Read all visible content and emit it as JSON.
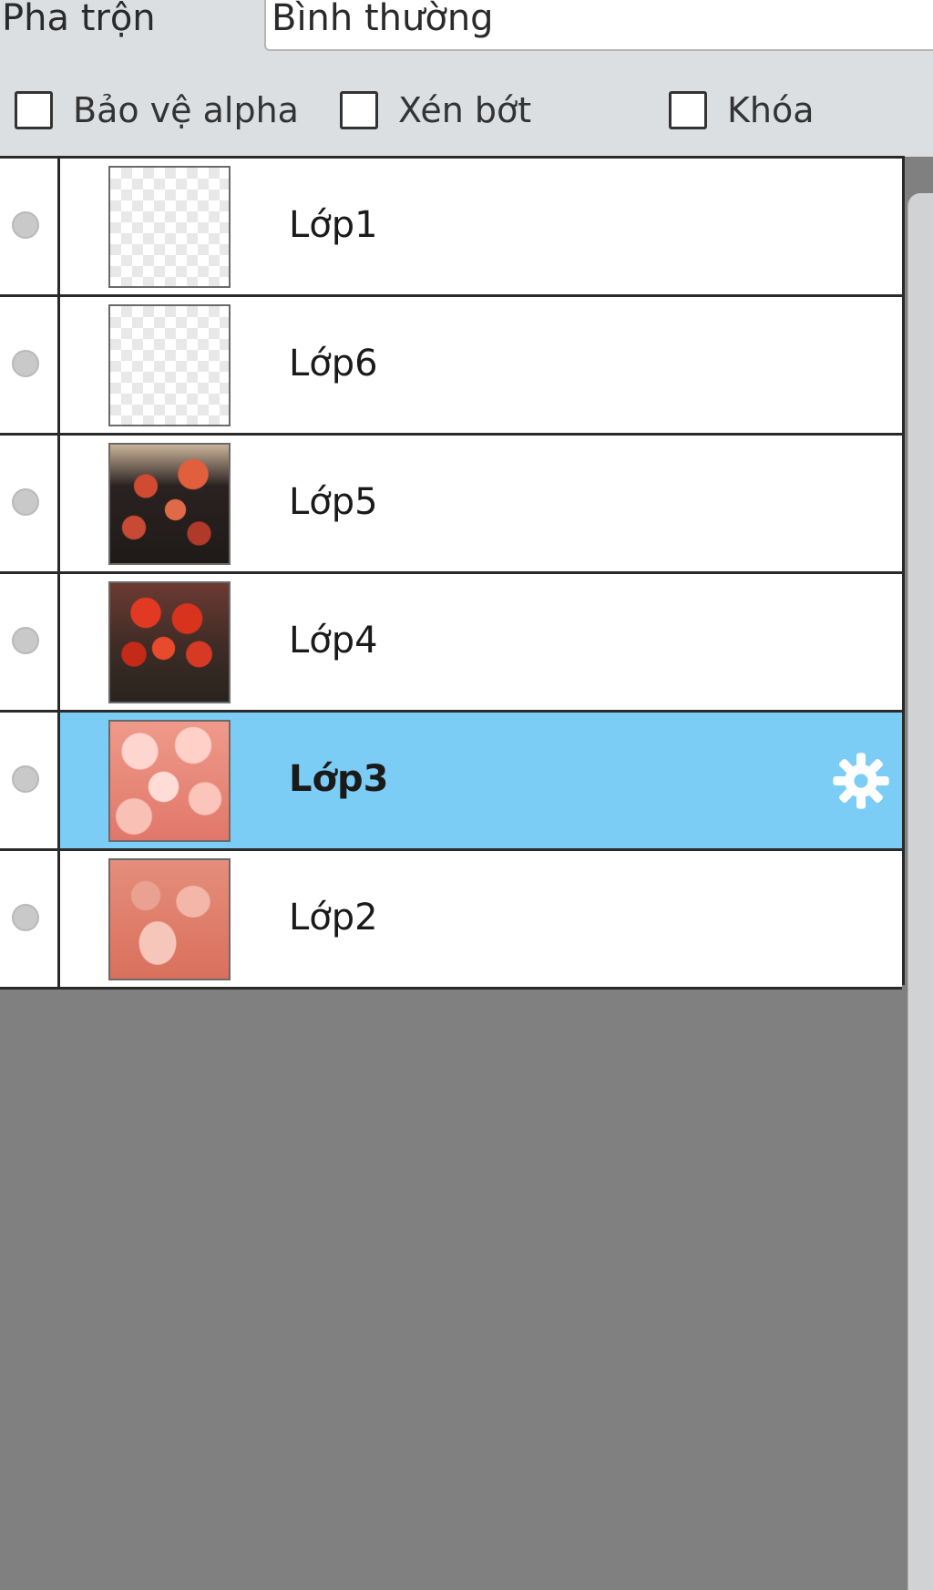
{
  "blend": {
    "label": "Pha trộn",
    "value": "Bình thường"
  },
  "options": [
    {
      "label": "Bảo vệ alpha",
      "checked": false
    },
    {
      "label": "Xén bớt",
      "checked": false
    },
    {
      "label": "Khóa",
      "checked": false
    }
  ],
  "layers": [
    {
      "name": "Lớp1",
      "thumb": "transparent",
      "selected": false
    },
    {
      "name": "Lớp6",
      "thumb": "transparent",
      "selected": false
    },
    {
      "name": "Lớp5",
      "thumb": "flowers-dark",
      "selected": false
    },
    {
      "name": "Lớp4",
      "thumb": "flowers-red",
      "selected": false
    },
    {
      "name": "Lớp3",
      "thumb": "peaches",
      "selected": true
    },
    {
      "name": "Lớp2",
      "thumb": "teacups",
      "selected": false
    }
  ],
  "colors": {
    "selected_row": "#7ccdf5",
    "panel_bg": "#dcdfe2",
    "empty_area": "#808080"
  },
  "icons": {
    "settings": "gear-icon",
    "visibility": "eye-dot-icon"
  }
}
